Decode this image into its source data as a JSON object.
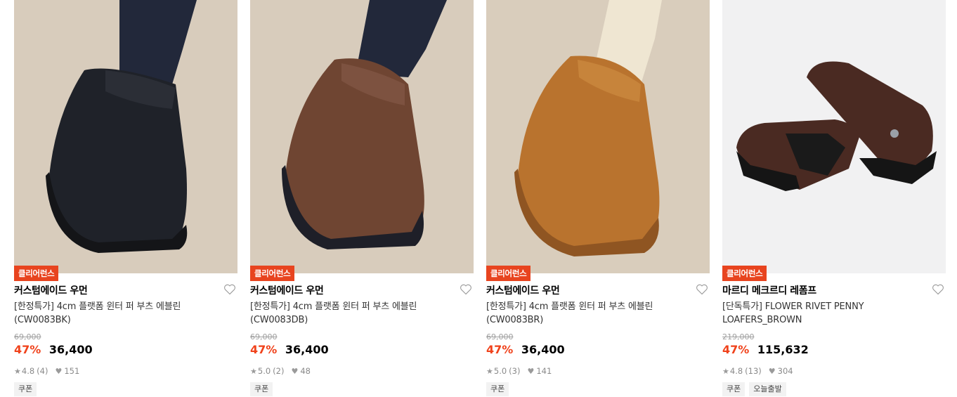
{
  "products": [
    {
      "badge": "클리어런스",
      "brand": "커스텀에이드 우먼",
      "name_line1": "[한정특가] 4cm 플랫폼 윈터 퍼 부츠 에블린",
      "name_line2": "(CW0083BK)",
      "original_price": "69,000",
      "discount": "47%",
      "price": "36,400",
      "rating": "4.8",
      "reviews": "(4)",
      "likes": "151",
      "tags": [
        "쿠폰"
      ],
      "color": "#1f2229"
    },
    {
      "badge": "클리어런스",
      "brand": "커스텀에이드 우먼",
      "name_line1": "[한정특가] 4cm 플랫폼 윈터 퍼 부츠 에블린",
      "name_line2": "(CW0083DB)",
      "original_price": "69,000",
      "discount": "47%",
      "price": "36,400",
      "rating": "5.0",
      "reviews": "(2)",
      "likes": "48",
      "tags": [
        "쿠폰"
      ],
      "color": "#6f4532"
    },
    {
      "badge": "클리어런스",
      "brand": "커스텀에이드 우먼",
      "name_line1": "[한정특가] 4cm 플랫폼 윈터 퍼 부츠 에블린",
      "name_line2": "(CW0083BR)",
      "original_price": "69,000",
      "discount": "47%",
      "price": "36,400",
      "rating": "5.0",
      "reviews": "(3)",
      "likes": "141",
      "tags": [
        "쿠폰"
      ],
      "color": "#b9732e"
    },
    {
      "badge": "클리어런스",
      "brand": "마르디 메크르디 레폼프",
      "name_line1": "[단독특가] FLOWER RIVET PENNY",
      "name_line2": "LOAFERS_BROWN",
      "original_price": "219,000",
      "discount": "47%",
      "price": "115,632",
      "rating": "4.8",
      "reviews": "(13)",
      "likes": "304",
      "tags": [
        "쿠폰",
        "오늘출발"
      ],
      "color": "#4a2a22"
    }
  ]
}
